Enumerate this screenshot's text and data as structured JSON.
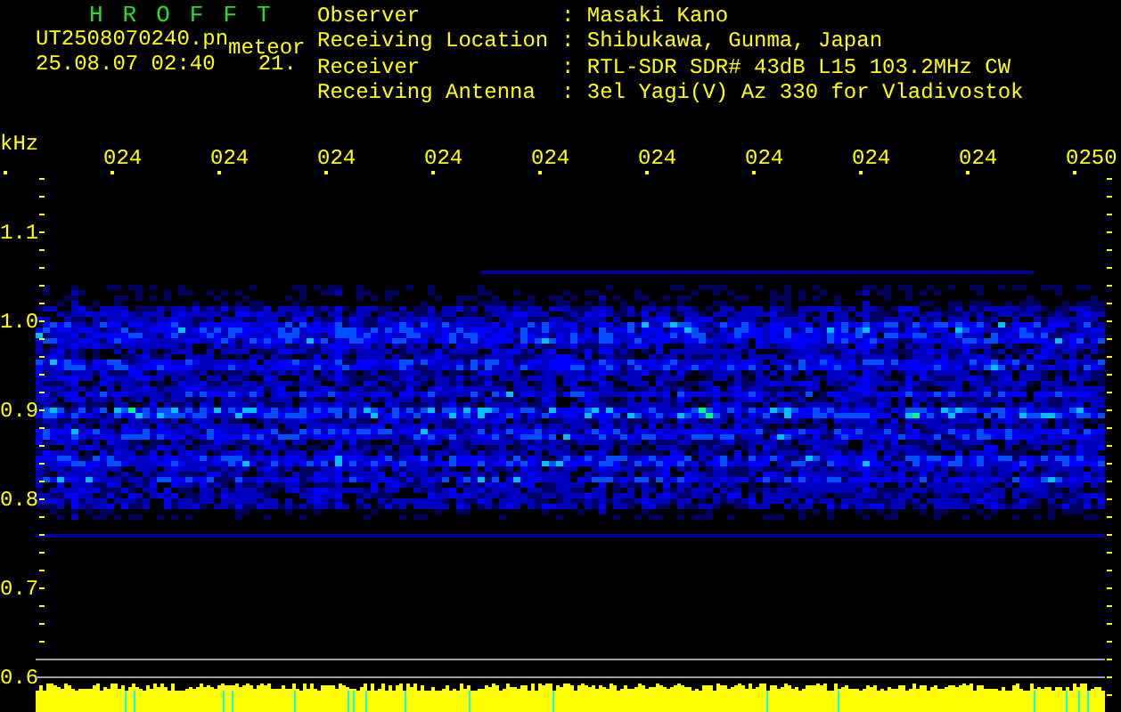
{
  "header": {
    "title": "H R O F F T",
    "filename": "UT2508070240.pn",
    "mode": "meteor",
    "datetime": "25.08.07 02:40",
    "value": "21."
  },
  "station": [
    {
      "label": "Observer",
      "value": ": Masaki Kano"
    },
    {
      "label": "Receiving Location",
      "value": ": Shibukawa, Gunma, Japan"
    },
    {
      "label": "Receiver",
      "value": ": RTL-SDR SDR# 43dB L15 103.2MHz CW"
    },
    {
      "label": "Receiving Antenna",
      "value": ": 3el Yagi(V) Az 330 for Vladivostok"
    }
  ],
  "axis": {
    "unit": "kHz",
    "x_labels": [
      "024",
      "024",
      "024",
      "024",
      "024",
      "024",
      "024",
      "024",
      "024",
      "0250"
    ],
    "y_labels": [
      "1.1",
      "1.0",
      "0.9",
      "0.8",
      "0.7",
      "0.6"
    ]
  }
}
